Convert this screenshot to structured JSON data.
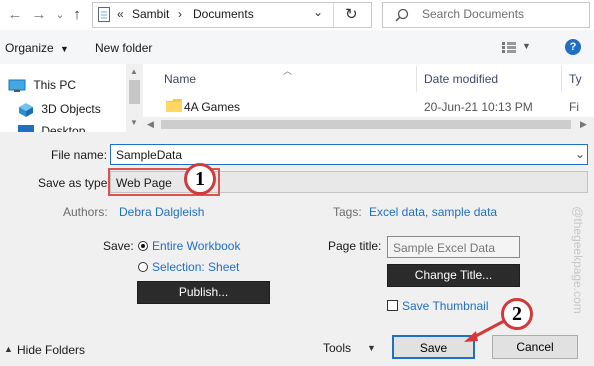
{
  "nav": {
    "back_glyph": "←",
    "forward_glyph": "→",
    "dropdown_glyph": "⌄",
    "up_glyph": "↑",
    "breadcrumb_sep_start": "«",
    "breadcrumb": [
      "Sambit",
      "Documents"
    ],
    "breadcrumb_sep": "›",
    "refresh_glyph": "↻",
    "search_placeholder": "Search Documents"
  },
  "toolbar": {
    "organize_label": "Organize",
    "new_folder_label": "New folder",
    "help_glyph": "?"
  },
  "sidebar": {
    "items": [
      {
        "label": "This PC",
        "icon": "computer-icon"
      },
      {
        "label": "3D Objects",
        "icon": "cube-icon"
      },
      {
        "label": "Desktop",
        "icon": "desktop-icon"
      }
    ]
  },
  "file_list": {
    "columns": [
      "Name",
      "Date modified",
      "Ty"
    ],
    "rows": [
      {
        "name": "4A Games",
        "date": "20-Jun-21 10:13 PM",
        "type": "Fi"
      }
    ]
  },
  "form": {
    "file_name_label": "File name:",
    "file_name_value": "SampleData",
    "save_type_label": "Save as type:",
    "save_type_value": "Web Page",
    "authors_label": "Authors:",
    "authors_value": "Debra Dalgleish",
    "tags_label": "Tags:",
    "tags_value": "Excel data, sample data",
    "save_label": "Save:",
    "entire_workbook": "Entire Workbook",
    "selection_sheet": "Selection: Sheet",
    "publish_label": "Publish...",
    "page_title_label": "Page title:",
    "page_title_value": "Sample Excel Data",
    "change_title_label": "Change Title...",
    "save_thumbnail_label": "Save Thumbnail"
  },
  "footer": {
    "hide_folders_label": "Hide Folders",
    "tools_label": "Tools",
    "save_button": "Save",
    "cancel_button": "Cancel"
  },
  "callouts": {
    "one": "1",
    "two": "2"
  },
  "watermark": "@thegeekpage.com",
  "colors": {
    "accent": "#1f6fc5",
    "callout_red": "#d23a3a",
    "highlight_box": "#d9534f"
  }
}
